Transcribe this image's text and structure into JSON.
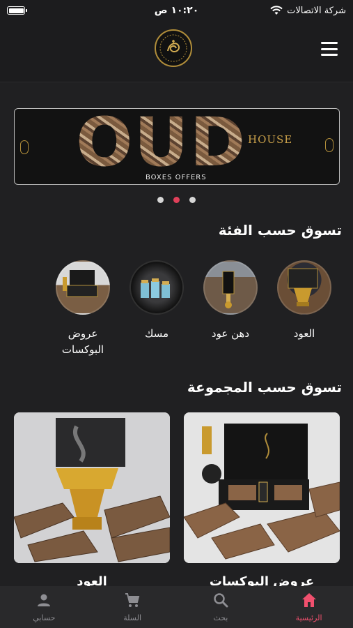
{
  "status_bar": {
    "time": "١٠:٢٠ ص",
    "carrier": "شركة الاتصالات"
  },
  "banner": {
    "headline": "OUD",
    "brand": "HOUSE",
    "subtitle": "BOXES OFFERS",
    "slide_count": 3,
    "active_slide": 2
  },
  "categories_section": {
    "title": "تسوق حسب الفئة",
    "items": [
      {
        "label": "العود",
        "icon": "oud-burner"
      },
      {
        "label": "دهن عود",
        "icon": "oil-bottle"
      },
      {
        "label": "مسك",
        "icon": "musk-bottles"
      },
      {
        "label": "عروض البوكسات",
        "icon": "gift-box"
      }
    ]
  },
  "collections_section": {
    "title": "تسوق حسب المجموعة",
    "items": [
      {
        "label": "عروض البوكسات"
      },
      {
        "label": "العود"
      }
    ]
  },
  "bottom_nav": {
    "items": [
      {
        "label": "الرئيسية",
        "icon": "home-icon",
        "active": true
      },
      {
        "label": "بحث",
        "icon": "search-icon",
        "active": false
      },
      {
        "label": "السلة",
        "icon": "cart-icon",
        "active": false
      },
      {
        "label": "حسابي",
        "icon": "account-icon",
        "active": false
      }
    ]
  },
  "colors": {
    "background": "#202022",
    "accent": "#f0506e",
    "gold": "#b08d3a"
  }
}
